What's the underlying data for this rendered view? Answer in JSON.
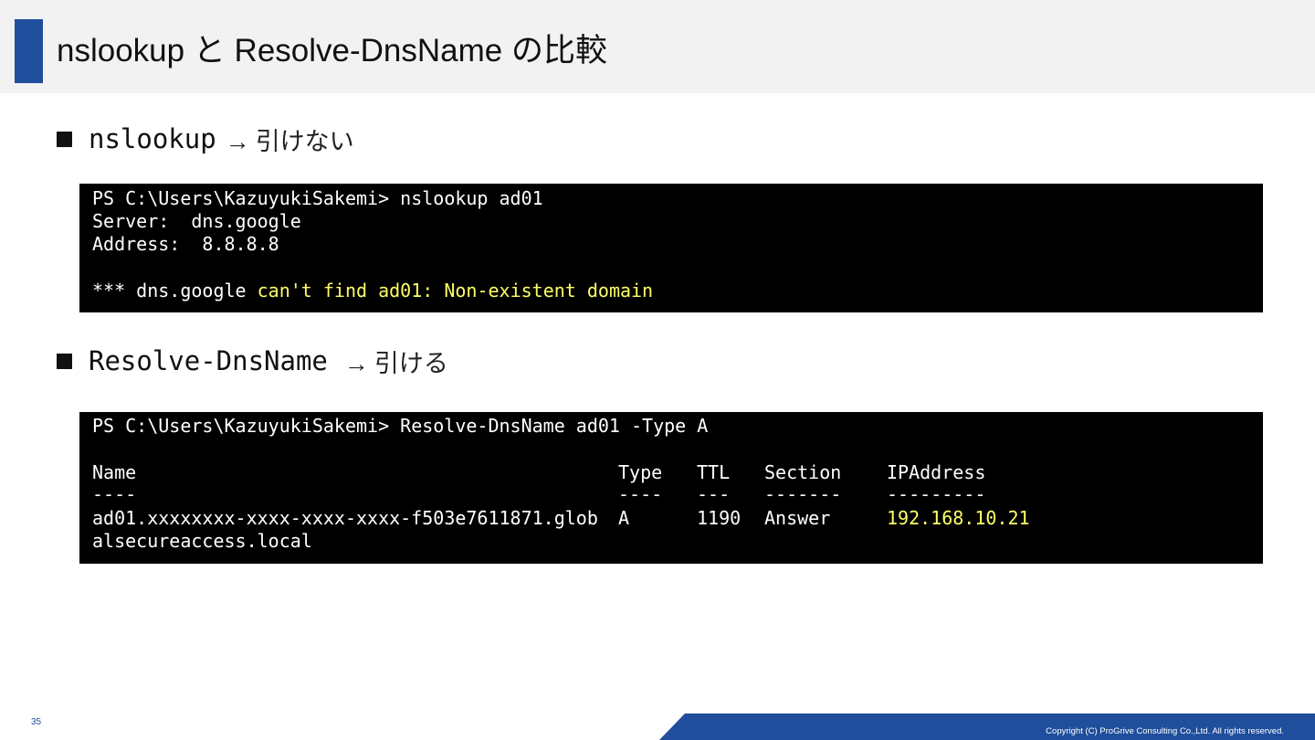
{
  "slide": {
    "title": "nslookup と Resolve-DnsName の比較",
    "page_number": "35",
    "copyright": "Copyright (C) ProGrive Consulting Co.,Ltd. All rights reserved."
  },
  "section1": {
    "command": "nslookup",
    "arrow": "→",
    "result": "引けない",
    "terminal": {
      "prompt_line": "PS C:\\Users\\KazuyukiSakemi> nslookup ad01",
      "server_line": "Server:  dns.google",
      "address_line": "Address:  8.8.8.8",
      "error_prefix": "*** dns.google ",
      "error_message": "can't find ad01: Non-existent domain"
    }
  },
  "section2": {
    "command": "Resolve-DnsName",
    "arrow": "→",
    "result": "引ける",
    "terminal": {
      "prompt_line": "PS C:\\Users\\KazuyukiSakemi> Resolve-DnsName ad01 -Type A",
      "headers": [
        "Name",
        "Type",
        "TTL",
        "Section",
        "IPAddress"
      ],
      "separators": [
        "----",
        "----",
        "---",
        "-------",
        "---------"
      ],
      "row": {
        "name_line1": "ad01.xxxxxxxx-xxxx-xxxx-xxxx-f503e7611871.glob",
        "name_line2": "alsecureaccess.local",
        "type": "A",
        "ttl": "1190",
        "section": "Answer",
        "ip": "192.168.10.21"
      }
    }
  },
  "colors": {
    "accent": "#1f4e9c",
    "terminal_bg": "#000000",
    "highlight": "#ffff66"
  }
}
